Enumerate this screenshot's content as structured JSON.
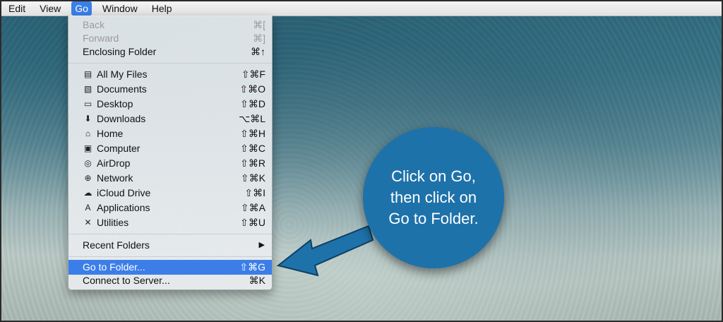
{
  "menubar": {
    "items": [
      "Edit",
      "View",
      "Go",
      "Window",
      "Help"
    ]
  },
  "go_menu": {
    "back": {
      "label": "Back",
      "shortcut": "⌘["
    },
    "forward": {
      "label": "Forward",
      "shortcut": "⌘]"
    },
    "enclosing": {
      "label": "Enclosing Folder",
      "shortcut": "⌘↑"
    },
    "places": [
      {
        "label": "All My Files",
        "shortcut": "⇧⌘F",
        "icon": "all-files-icon",
        "glyph": "▤"
      },
      {
        "label": "Documents",
        "shortcut": "⇧⌘O",
        "icon": "documents-icon",
        "glyph": "▧"
      },
      {
        "label": "Desktop",
        "shortcut": "⇧⌘D",
        "icon": "desktop-icon",
        "glyph": "▭"
      },
      {
        "label": "Downloads",
        "shortcut": "⌥⌘L",
        "icon": "downloads-icon",
        "glyph": "⬇"
      },
      {
        "label": "Home",
        "shortcut": "⇧⌘H",
        "icon": "home-icon",
        "glyph": "⌂"
      },
      {
        "label": "Computer",
        "shortcut": "⇧⌘C",
        "icon": "computer-icon",
        "glyph": "▣"
      },
      {
        "label": "AirDrop",
        "shortcut": "⇧⌘R",
        "icon": "airdrop-icon",
        "glyph": "◎"
      },
      {
        "label": "Network",
        "shortcut": "⇧⌘K",
        "icon": "network-icon",
        "glyph": "⊕"
      },
      {
        "label": "iCloud Drive",
        "shortcut": "⇧⌘I",
        "icon": "icloud-icon",
        "glyph": "☁"
      },
      {
        "label": "Applications",
        "shortcut": "⇧⌘A",
        "icon": "applications-icon",
        "glyph": "A"
      },
      {
        "label": "Utilities",
        "shortcut": "⇧⌘U",
        "icon": "utilities-icon",
        "glyph": "✕"
      }
    ],
    "recent": {
      "label": "Recent Folders",
      "arrow": "▶"
    },
    "go_to_folder": {
      "label": "Go to Folder...",
      "shortcut": "⇧⌘G"
    },
    "connect": {
      "label": "Connect to Server...",
      "shortcut": "⌘K"
    }
  },
  "callout": {
    "lines": [
      "Click on Go,",
      "then click on",
      "Go to Folder."
    ]
  },
  "colors": {
    "highlight": "#3b7ee8",
    "callout": "#1e72aa"
  }
}
